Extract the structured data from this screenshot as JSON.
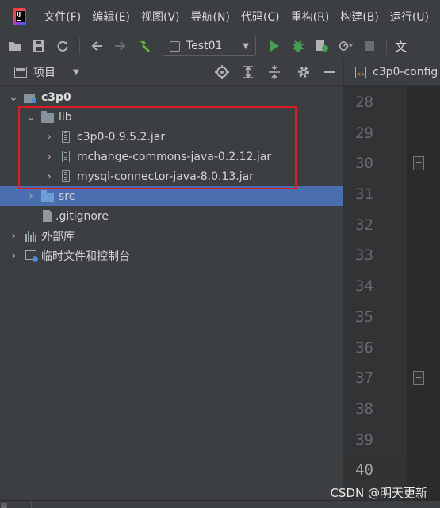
{
  "menubar": {
    "items": [
      "文件(F)",
      "编辑(E)",
      "视图(V)",
      "导航(N)",
      "代码(C)",
      "重构(R)",
      "构建(B)",
      "运行(U)"
    ]
  },
  "toolbar": {
    "run_config": "Test01",
    "overflow_glyph": "文"
  },
  "project_panel": {
    "title": "项目",
    "tree": [
      {
        "label": "c3p0",
        "icon": "module-icon",
        "expanded": true
      },
      {
        "label": "lib",
        "icon": "folder-icon",
        "expanded": true
      },
      {
        "label": "c3p0-0.9.5.2.jar",
        "icon": "jar-icon"
      },
      {
        "label": "mchange-commons-java-0.2.12.jar",
        "icon": "jar-icon"
      },
      {
        "label": "mysql-connector-java-8.0.13.jar",
        "icon": "jar-icon"
      },
      {
        "label": "src",
        "icon": "source-folder-icon",
        "selected": true
      },
      {
        "label": ".gitignore",
        "icon": "git-file-icon"
      },
      {
        "label": "外部库",
        "icon": "external-libraries-icon"
      },
      {
        "label": "临时文件和控制台",
        "icon": "scratches-icon"
      }
    ]
  },
  "editor": {
    "tab_label": "c3p0-config",
    "line_numbers": [
      "28",
      "29",
      "30",
      "31",
      "32",
      "33",
      "34",
      "35",
      "36",
      "37",
      "38",
      "39",
      "40"
    ]
  },
  "watermark": "CSDN @明天更新",
  "bottom_bar": {
    "label": "调"
  },
  "colors": {
    "selection": "#4b6eaf",
    "highlight_border": "#e01b24",
    "run_green": "#499c54"
  }
}
